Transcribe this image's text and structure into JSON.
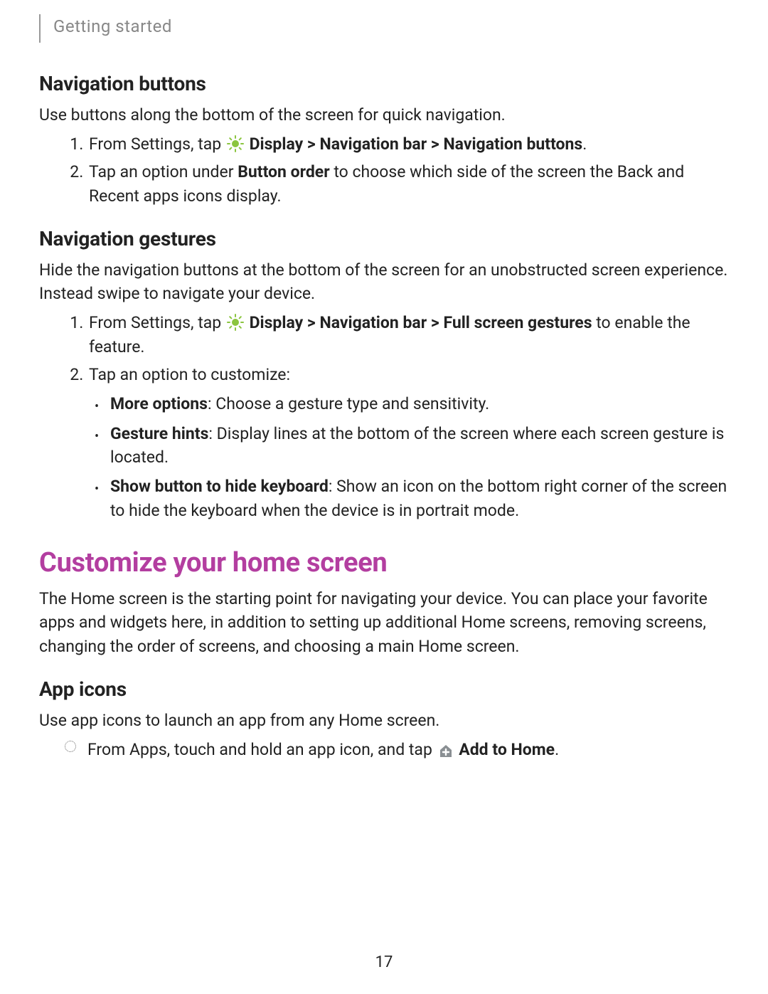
{
  "header": {
    "section": "Getting started"
  },
  "navButtons": {
    "title": "Navigation buttons",
    "intro": "Use buttons along the bottom of the screen for quick navigation.",
    "step1_pre": "From Settings, tap ",
    "step1_bold": "Display > Navigation bar > Navigation buttons",
    "step1_post": ".",
    "step2_pre": "Tap an option under ",
    "step2_bold": "Button order",
    "step2_post": " to choose which side of the screen the Back and Recent apps icons display."
  },
  "navGestures": {
    "title": "Navigation gestures",
    "intro": "Hide the navigation buttons at the bottom of the screen for an unobstructed screen experience. Instead swipe to navigate your device.",
    "step1_pre": "From Settings, tap ",
    "step1_bold": "Display > Navigation bar > Full screen gestures",
    "step1_post": " to enable the feature.",
    "step2": "Tap an option to customize:",
    "b1_bold": "More options",
    "b1_rest": ": Choose a gesture type and sensitivity.",
    "b2_bold": "Gesture hints",
    "b2_rest": ": Display lines at the bottom of the screen where each screen gesture is located.",
    "b3_bold": "Show button to hide keyboard",
    "b3_rest": ": Show an icon on the bottom right corner of the screen to hide the keyboard when the device is in portrait mode."
  },
  "customize": {
    "title": "Customize your home screen",
    "intro": "The Home screen is the starting point for navigating your device. You can place your favorite apps and widgets here, in addition to setting up additional Home screens, removing screens, changing the order of screens, and choosing a main Home screen."
  },
  "appIcons": {
    "title": "App icons",
    "intro": "Use app icons to launch an app from any Home screen.",
    "item_pre": "From Apps, touch and hold an app icon, and tap ",
    "item_bold": "Add to Home",
    "item_post": "."
  },
  "page": "17"
}
